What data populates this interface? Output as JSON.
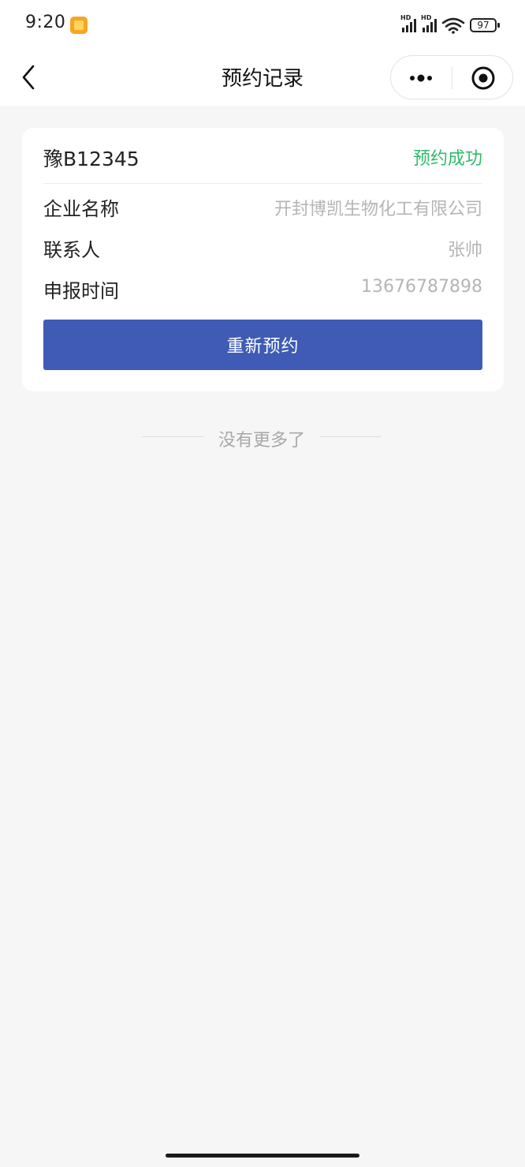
{
  "status_bar": {
    "time": "9:20",
    "signal_1_label": "HD",
    "signal_2_label": "HD",
    "battery": "97"
  },
  "nav": {
    "title": "预约记录",
    "back_icon": "chevron-left-icon",
    "more_icon": "more-dots-icon",
    "close_icon": "target-close-icon"
  },
  "record": {
    "plate": "豫B12345",
    "status": "预约成功",
    "status_color": "#2dbb6a",
    "rows": [
      {
        "label": "企业名称",
        "value": "开封博凯生物化工有限公司"
      },
      {
        "label": "联系人",
        "value": "张帅"
      },
      {
        "label": "申报时间",
        "value": "13676787898"
      }
    ],
    "button_label": "重新预约",
    "button_color": "#3f5bb5"
  },
  "footer": {
    "no_more": "没有更多了"
  }
}
